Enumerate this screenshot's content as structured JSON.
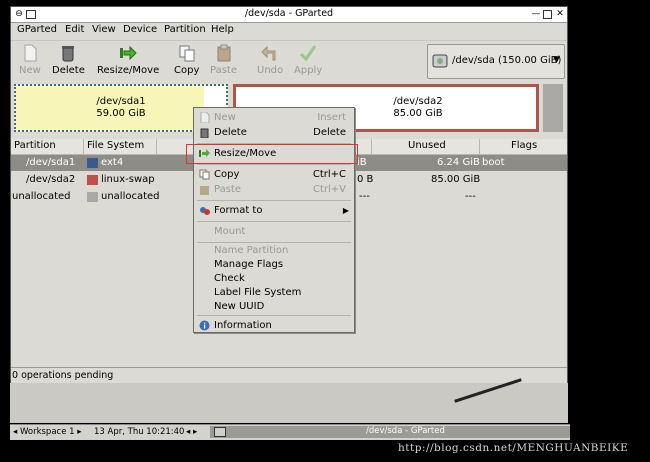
{
  "window": {
    "title": "/dev/sda - GParted"
  },
  "menu": [
    "GParted",
    "Edit",
    "View",
    "Device",
    "Partition",
    "Help"
  ],
  "toolbar": {
    "new": "New",
    "delete": "Delete",
    "resize": "Resize/Move",
    "copy": "Copy",
    "paste": "Paste",
    "undo": "Undo",
    "apply": "Apply"
  },
  "device_selector": {
    "value": "/dev/sda  (150.00 GiB)"
  },
  "graph": {
    "p1_name": "/dev/sda1",
    "p1_size": "59.00 GiB",
    "p2_name": "/dev/sda2",
    "p2_size": "85.00 GiB"
  },
  "table": {
    "headers": {
      "partition": "Partition",
      "filesystem": "File System",
      "unused": "Unused",
      "flags": "Flags"
    },
    "rows": [
      {
        "partition": "/dev/sda1",
        "fs": "ext4",
        "used_tail": "iB",
        "unused": "6.24 GiB",
        "flags": "boot",
        "color": "#3b5a8c"
      },
      {
        "partition": "/dev/sda2",
        "fs": "linux-swap",
        "used_tail": "0 B",
        "unused": "85.00 GiB",
        "flags": "",
        "color": "#c0504a"
      },
      {
        "partition": "unallocated",
        "fs": "unallocated",
        "used_tail": "---",
        "unused": "---",
        "flags": "",
        "color": "#a8a8a8"
      }
    ]
  },
  "status": "0 operations pending",
  "context_menu": {
    "new": "New",
    "new_acc": "Insert",
    "delete": "Delete",
    "delete_acc": "Delete",
    "resize": "Resize/Move",
    "copy": "Copy",
    "copy_acc": "Ctrl+C",
    "paste": "Paste",
    "paste_acc": "Ctrl+V",
    "format": "Format to",
    "mount": "Mount",
    "name_partition": "Name Partition",
    "manage_flags": "Manage Flags",
    "check": "Check",
    "label_fs": "Label File System",
    "new_uuid": "New UUID",
    "information": "Information"
  },
  "taskbar": {
    "workspace": "◂ Workspace 1 ▸",
    "datetime": "13 Apr, Thu 10:21:40",
    "nav": "◂ ▸",
    "task": "/dev/sda - GParted"
  },
  "watermark": "http://blog.csdn.net/MENGHUANBEIKE"
}
